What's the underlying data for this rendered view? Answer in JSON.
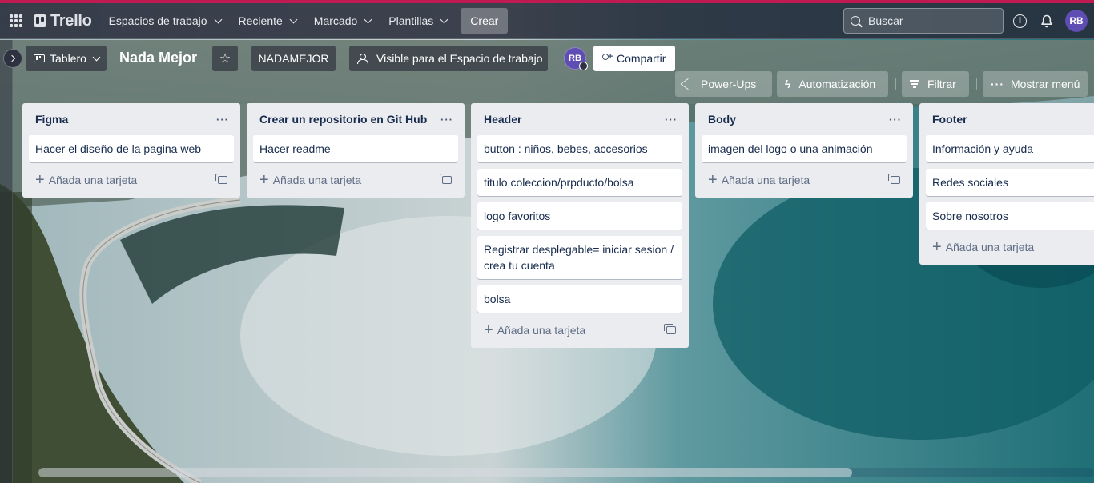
{
  "header": {
    "apps_icon": "apps-grid-icon",
    "logo_text": "Trello",
    "nav": [
      {
        "label": "Espacios de trabajo"
      },
      {
        "label": "Reciente"
      },
      {
        "label": "Marcado"
      },
      {
        "label": "Plantillas"
      }
    ],
    "create_label": "Crear",
    "search_placeholder": "Buscar",
    "avatar_initials": "RB",
    "accent_color": "#c01a53"
  },
  "board": {
    "view_label": "Tablero",
    "title": "Nada Mejor",
    "workspace_label": "NADAMEJOR",
    "visibility_label": "Visible para el Espacio de trabajo",
    "member_initials": "RB",
    "share_label": "Compartir",
    "powerups_label": "Power-Ups",
    "automation_label": "Automatización",
    "filter_label": "Filtrar",
    "menu_label": "Mostrar menú"
  },
  "add_card_label": "Añada una tarjeta",
  "lists": [
    {
      "title": "Figma",
      "cards": [
        "Hacer el diseño de la pagina web"
      ]
    },
    {
      "title": "Crear un repositorio en Git Hub",
      "cards": [
        "Hacer readme"
      ]
    },
    {
      "title": "Header",
      "cards": [
        "button : niños, bebes, accesorios",
        "titulo coleccion/prpducto/bolsa",
        "logo favoritos",
        "Registrar desplegable= iniciar sesion / crea tu cuenta",
        "bolsa"
      ]
    },
    {
      "title": "Body",
      "cards": [
        "imagen del logo o una animación"
      ]
    },
    {
      "title": "Footer",
      "cards": [
        "Información y ayuda",
        "Redes sociales",
        "Sobre nosotros"
      ]
    }
  ]
}
